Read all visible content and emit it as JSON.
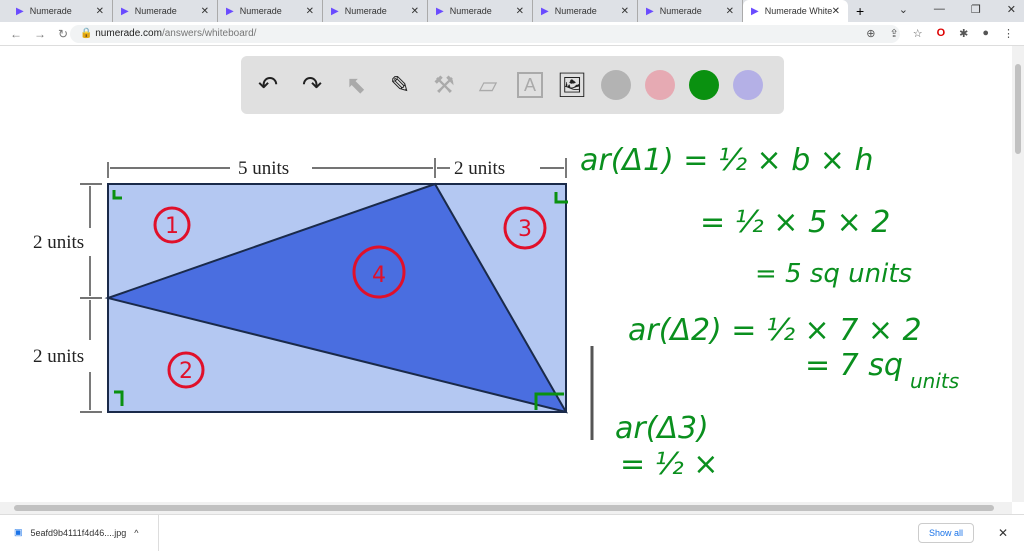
{
  "browser": {
    "tabs": [
      "Numerade",
      "Numerade",
      "Numerade",
      "Numerade",
      "Numerade",
      "Numerade",
      "Numerade",
      "Numerade White"
    ],
    "url_host": "numerade.com",
    "url_path": "/answers/whiteboard/"
  },
  "toolbar": {
    "tools": [
      "undo-icon",
      "redo-icon",
      "select-icon",
      "pen-icon",
      "tools-icon",
      "eraser-icon",
      "text-icon",
      "image-icon"
    ],
    "colors": [
      "#b3b3b3",
      "#e6aab3",
      "#0a9110",
      "#b4b0e6"
    ]
  },
  "figure": {
    "top_label": "5 units",
    "top_right_label": "2 units",
    "left_top_label": "2 units",
    "left_bottom_label": "2 units",
    "regions": [
      "1",
      "2",
      "3",
      "4"
    ],
    "light_color": "#b4c8f2",
    "dark_color": "#4a6ee0"
  },
  "notes": [
    "ar(Δ1) = ½ × b × h",
    "= ½ × 5 × 2",
    "= 5 sq units",
    "ar(Δ2) = ½ × 7 × 2",
    "= 7 sq",
    "units",
    "ar(Δ3)",
    "= ½ ×"
  ],
  "downloads": {
    "file": "5eafd9b4111f4d46....jpg",
    "show_all": "Show all"
  }
}
